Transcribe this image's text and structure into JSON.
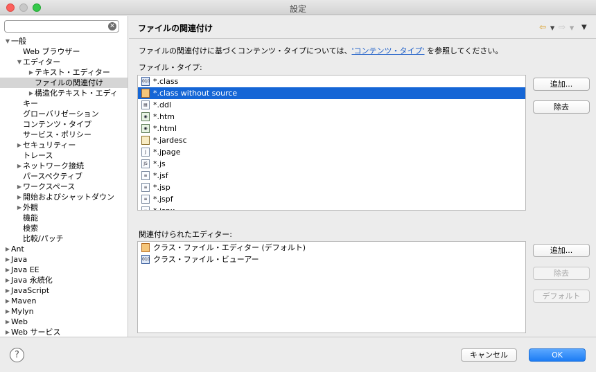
{
  "window": {
    "title": "設定"
  },
  "sidebar": {
    "filter": {
      "value": "",
      "placeholder": ""
    },
    "tree": [
      {
        "label": "一般",
        "level": 0,
        "twisty": "open"
      },
      {
        "label": "Web ブラウザー",
        "level": 1,
        "twisty": "none"
      },
      {
        "label": "エディター",
        "level": 1,
        "twisty": "open"
      },
      {
        "label": "テキスト・エディター",
        "level": 2,
        "twisty": "closed"
      },
      {
        "label": "ファイルの関連付け",
        "level": 2,
        "twisty": "none",
        "selected": true
      },
      {
        "label": "構造化テキスト・エディ",
        "level": 2,
        "twisty": "closed"
      },
      {
        "label": "キー",
        "level": 1,
        "twisty": "none"
      },
      {
        "label": "グローバリゼーション",
        "level": 1,
        "twisty": "none"
      },
      {
        "label": "コンテンツ・タイプ",
        "level": 1,
        "twisty": "none"
      },
      {
        "label": "サービス・ポリシー",
        "level": 1,
        "twisty": "none"
      },
      {
        "label": "セキュリティー",
        "level": 1,
        "twisty": "closed"
      },
      {
        "label": "トレース",
        "level": 1,
        "twisty": "none"
      },
      {
        "label": "ネットワーク接続",
        "level": 1,
        "twisty": "closed"
      },
      {
        "label": "パースペクティブ",
        "level": 1,
        "twisty": "none"
      },
      {
        "label": "ワークスペース",
        "level": 1,
        "twisty": "closed"
      },
      {
        "label": "開始およびシャットダウン",
        "level": 1,
        "twisty": "closed"
      },
      {
        "label": "外観",
        "level": 1,
        "twisty": "closed"
      },
      {
        "label": "機能",
        "level": 1,
        "twisty": "none"
      },
      {
        "label": "検索",
        "level": 1,
        "twisty": "none"
      },
      {
        "label": "比較/パッチ",
        "level": 1,
        "twisty": "none"
      },
      {
        "label": "Ant",
        "level": 0,
        "twisty": "closed"
      },
      {
        "label": "Java",
        "level": 0,
        "twisty": "closed"
      },
      {
        "label": "Java EE",
        "level": 0,
        "twisty": "closed"
      },
      {
        "label": "Java 永続化",
        "level": 0,
        "twisty": "closed"
      },
      {
        "label": "JavaScript",
        "level": 0,
        "twisty": "closed"
      },
      {
        "label": "Maven",
        "level": 0,
        "twisty": "closed"
      },
      {
        "label": "Mylyn",
        "level": 0,
        "twisty": "closed"
      },
      {
        "label": "Web",
        "level": 0,
        "twisty": "closed"
      },
      {
        "label": "Web サービス",
        "level": 0,
        "twisty": "closed"
      }
    ]
  },
  "page": {
    "title": "ファイルの関連付け",
    "description_pre": "ファイルの関連付けに基づくコンテンツ・タイプについては、",
    "description_link": "'コンテンツ・タイプ'",
    "description_post": " を参照してください。",
    "file_types_label": "ファイル・タイプ:",
    "file_types": [
      {
        "name": "*.class",
        "icon": "binary-class-icon"
      },
      {
        "name": "*.class without source",
        "icon": "coffee-cup-icon",
        "selected": true
      },
      {
        "name": "*.ddl",
        "icon": "ddl-file-icon"
      },
      {
        "name": "*.htm",
        "icon": "html-file-icon"
      },
      {
        "name": "*.html",
        "icon": "html-file-icon"
      },
      {
        "name": "*.jardesc",
        "icon": "jar-desc-icon"
      },
      {
        "name": "*.jpage",
        "icon": "jpage-file-icon"
      },
      {
        "name": "*.js",
        "icon": "js-file-icon"
      },
      {
        "name": "*.jsf",
        "icon": "text-file-icon"
      },
      {
        "name": "*.jsp",
        "icon": "text-file-icon"
      },
      {
        "name": "*.jspf",
        "icon": "text-file-icon"
      },
      {
        "name": "*.jspx",
        "icon": "text-file-icon"
      }
    ],
    "file_type_buttons": {
      "add": "追加...",
      "remove": "除去"
    },
    "editors_label": "関連付けられたエディター:",
    "editors": [
      {
        "name": "クラス・ファイル・エディター (デフォルト)",
        "icon": "coffee-cup-icon"
      },
      {
        "name": "クラス・ファイル・ビューアー",
        "icon": "binary-class-icon"
      }
    ],
    "editor_buttons": {
      "add": "追加...",
      "remove": "除去",
      "default": "デフォルト"
    }
  },
  "footer": {
    "cancel": "キャンセル",
    "ok": "OK"
  },
  "colors": {
    "selection": "#1566d6",
    "ok_button": "#1c7cf4",
    "link": "#1a5cc8"
  }
}
